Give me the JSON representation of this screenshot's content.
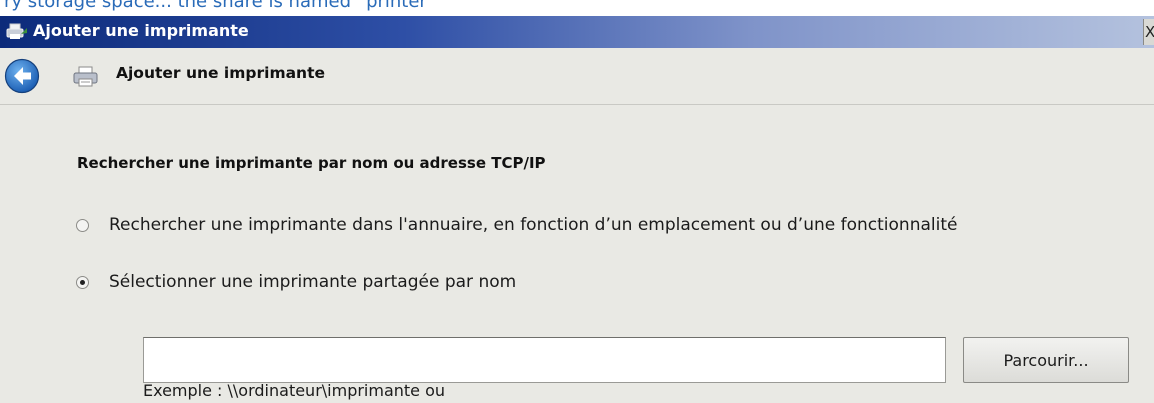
{
  "page_fragment": "ry storage space... the share is named “printer”",
  "window": {
    "title": "Ajouter une imprimante",
    "close_glyph": "X"
  },
  "nav": {
    "title": "Ajouter une imprimante"
  },
  "main": {
    "heading": "Rechercher une imprimante par nom ou adresse TCP/IP",
    "options": [
      {
        "label": "Rechercher une imprimante dans l'annuaire, en fonction d’un emplacement ou d’une fonctionnalité",
        "selected": false
      },
      {
        "label": "Sélectionner une imprimante partagée par nom",
        "selected": true
      }
    ],
    "share_name": {
      "value": "",
      "placeholder": ""
    },
    "browse_label": "Parcourir...",
    "example": "Exemple : \\\\ordinateur\\imprimante ou"
  }
}
